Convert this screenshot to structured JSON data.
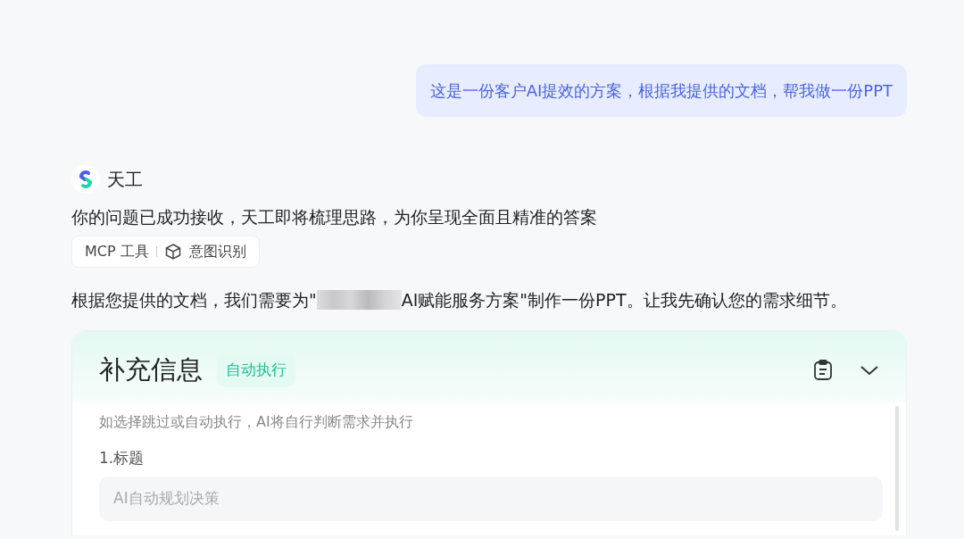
{
  "user_message": "这是一份客户AI提效的方案，根据我提供的文档，帮我做一份PPT",
  "assistant": {
    "name": "天工",
    "status_text": "你的问题已成功接收，天工即将梳理思路，为你呈现全面且精准的答案",
    "tools": [
      {
        "kind": "text",
        "label": "MCP 工具"
      },
      {
        "kind": "cube",
        "label": "意图识别"
      }
    ],
    "reply_parts": [
      "根据您提供的文档，我们需要为\"",
      "AI赋能服务方案\"制作一份PPT。让我先确认您的需求细节。"
    ]
  },
  "card": {
    "title": "补充信息",
    "badge": "自动执行",
    "hint": "如选择跳过或自动执行，AI将自行判断需求并执行",
    "expanded": true,
    "fields": [
      {
        "label": "1.标题",
        "placeholder": "AI自动规划决策"
      }
    ]
  }
}
